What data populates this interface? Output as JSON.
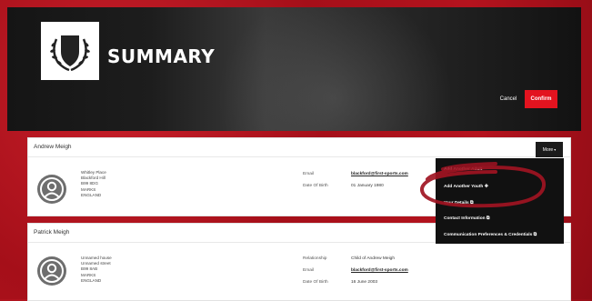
{
  "header": {
    "title": "SUMMARY",
    "cancel_label": "Cancel",
    "confirm_label": "Confirm"
  },
  "primary": {
    "name": "Andrew Meigh",
    "address": [
      "Whitley Place",
      "Blackford Hill",
      "B99 8DG",
      "MARKS",
      "ENGLAND"
    ],
    "email_label": "Email",
    "email_value": "blackford@first-sports.com",
    "dob_label": "Date Of Birth",
    "dob_value": "01 January 1980",
    "more_label": "More"
  },
  "menu": {
    "items": [
      {
        "label": "Add Another Adult"
      },
      {
        "label": "Add Another Youth"
      },
      {
        "label": "Your Details"
      },
      {
        "label": "Contact Information"
      },
      {
        "label": "Communication Preferences & Credentials"
      }
    ]
  },
  "secondary": {
    "name": "Patrick Meigh",
    "address": [
      "Unnamed house",
      "Unnamed street",
      "B99 8AB",
      "MARKS",
      "ENGLAND"
    ],
    "relationship_label": "Relationship",
    "relationship_value": "Child of Andrew Meigh",
    "email_label": "Email",
    "email_value": "blackford@first-sports.com",
    "dob_label": "Date Of Birth",
    "dob_value": "16 June 2003"
  },
  "colors": {
    "brand_red": "#e3131f",
    "annotation": "#a01322",
    "menu_bg": "#111111"
  },
  "icons": [
    "laurel-shield-logo-icon",
    "person-avatar-icon",
    "chevron-down-icon",
    "plus-icon",
    "external-link-icon"
  ]
}
